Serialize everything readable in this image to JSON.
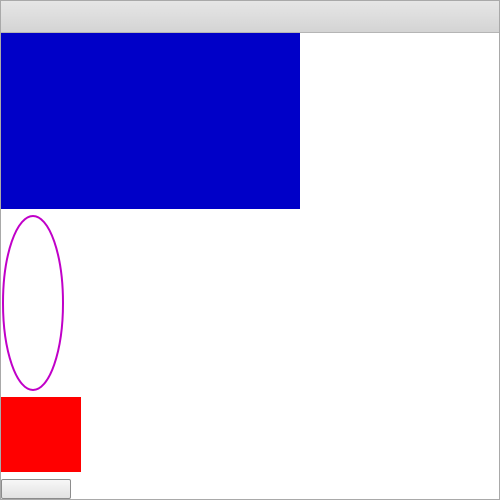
{
  "window": {
    "title": ""
  },
  "shapes": {
    "blue_rect_color": "#0000c8",
    "ellipse_stroke_color": "#c000c8",
    "red_rect_color": "#ff0000"
  },
  "bottom_button": {
    "label": ""
  }
}
